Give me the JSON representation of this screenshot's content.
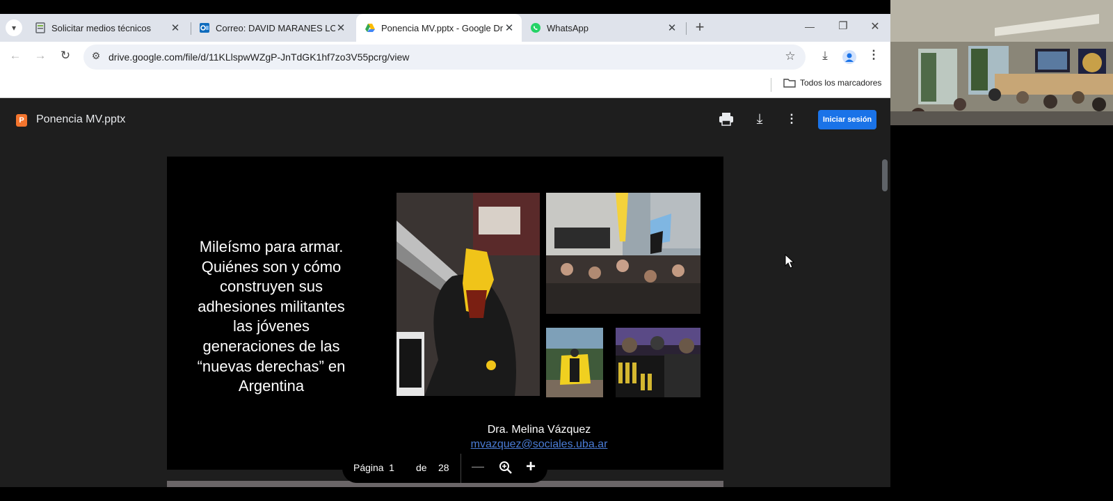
{
  "tabs": [
    {
      "label": "Solicitar medios técnicos",
      "icon": "form-icon"
    },
    {
      "label": "Correo: DAVID MARANES LOPE",
      "icon": "outlook-icon"
    },
    {
      "label": "Ponencia MV.pptx - Google Dri",
      "icon": "google-drive-icon"
    },
    {
      "label": "WhatsApp",
      "icon": "whatsapp-icon"
    }
  ],
  "address_bar": {
    "url": "drive.google.com/file/d/11KLlspwWZgP-JnTdGK1hf7zo3V55pcrg/view"
  },
  "bookmarks": {
    "all_bookmarks": "Todos los marcadores"
  },
  "viewer": {
    "file_name": "Ponencia MV.pptx",
    "signin_label": "Iniciar sesión"
  },
  "slide": {
    "title_lines": [
      "Mileísmo para armar.",
      "Quiénes son y cómo",
      "construyen sus",
      "adhesiones militantes",
      "las jóvenes",
      "generaciones de las",
      "“nuevas derechas” en",
      "Argentina"
    ],
    "author": "Dra. Melina Vázquez",
    "email": "mvazquez@sociales.uba.ar"
  },
  "pagination": {
    "page_label": "Página",
    "current_page": "1",
    "of_label": "de",
    "total_pages": "28"
  },
  "colors": {
    "accent_blue": "#1a73e8",
    "viewer_bg": "#1e1e1e",
    "slide_bg": "#000000",
    "link": "#4a7cd6"
  }
}
